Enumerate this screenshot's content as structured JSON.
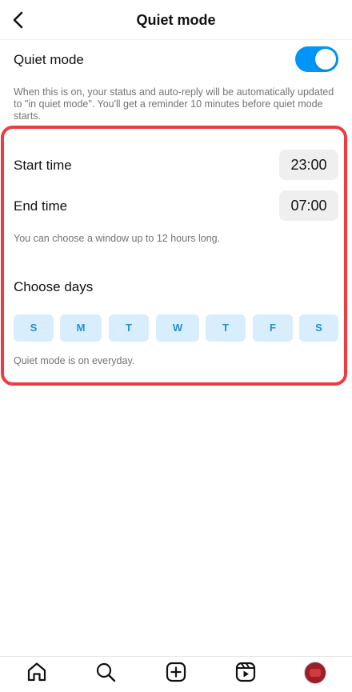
{
  "header": {
    "title": "Quiet mode"
  },
  "quiet_mode": {
    "label": "Quiet mode",
    "enabled": true,
    "description": "When this is on, your status and auto-reply will be automatically updated to \"in quiet mode\". You'll get a reminder 10 minutes before quiet mode starts."
  },
  "schedule": {
    "start_label": "Start time",
    "start_value": "23:00",
    "end_label": "End time",
    "end_value": "07:00",
    "window_note": "You can choose a window up to 12 hours long."
  },
  "days": {
    "title": "Choose days",
    "items": [
      {
        "label": "S",
        "selected": true
      },
      {
        "label": "M",
        "selected": true
      },
      {
        "label": "T",
        "selected": true
      },
      {
        "label": "W",
        "selected": true
      },
      {
        "label": "T",
        "selected": true
      },
      {
        "label": "F",
        "selected": true
      },
      {
        "label": "S",
        "selected": true
      }
    ],
    "note": "Quiet mode is on everyday."
  },
  "colors": {
    "accent": "#0095f6",
    "day_chip_bg": "#d9eefc",
    "day_chip_text": "#1f90d6",
    "highlight": "#ef3a3f"
  },
  "tabbar": {
    "items": [
      "home-icon",
      "search-icon",
      "create-icon",
      "reels-icon",
      "profile-avatar"
    ]
  }
}
